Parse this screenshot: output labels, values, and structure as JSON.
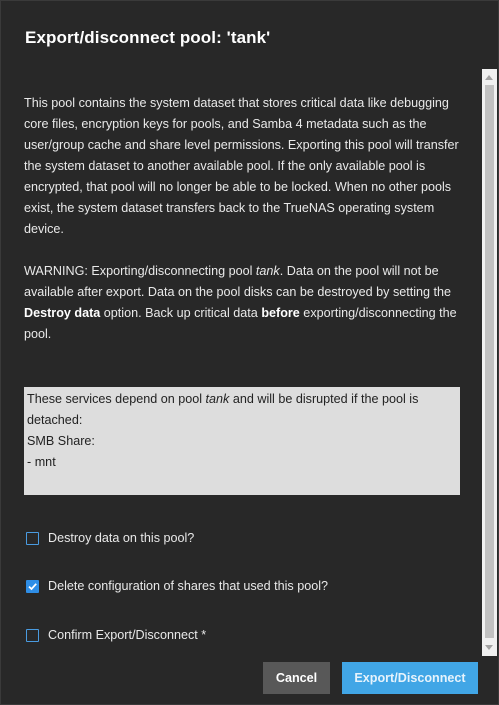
{
  "dialog": {
    "title": "Export/disconnect pool: 'tank'",
    "info_text": "This pool contains the system dataset that stores critical data like debugging core files, encryption keys for pools, and Samba 4 metadata such as the user/group cache and share level permissions. Exporting this pool will transfer the system dataset to another available pool. If the only available pool is encrypted, that pool will no longer be able to be locked. When no other pools exist, the system dataset transfers back to the TrueNAS operating system device.",
    "warning": {
      "prefix": "WARNING: Exporting/disconnecting pool ",
      "pool": "tank",
      "mid1": ". Data on the pool will not be available after export. Data on the pool disks can be destroyed by setting the ",
      "destroy": "Destroy data",
      "mid2": " option. Back up critical data ",
      "before": "before",
      "suffix": " exporting/disconnecting the pool."
    },
    "services": {
      "intro_prefix": "These services depend on pool ",
      "pool": "tank",
      "intro_suffix": " and will be disrupted if the pool is detached:",
      "heading": "SMB Share:",
      "item": "- mnt"
    },
    "checkboxes": [
      {
        "label": "Destroy data on this pool?",
        "checked": false
      },
      {
        "label": "Delete configuration of shares that used this pool?",
        "checked": true
      },
      {
        "label": "Confirm Export/Disconnect *",
        "checked": false
      }
    ],
    "buttons": {
      "cancel": "Cancel",
      "export": "Export/Disconnect"
    }
  },
  "colors": {
    "background": "#282828",
    "accent": "#41a6e6",
    "checkbox": "#2f8ee6"
  }
}
